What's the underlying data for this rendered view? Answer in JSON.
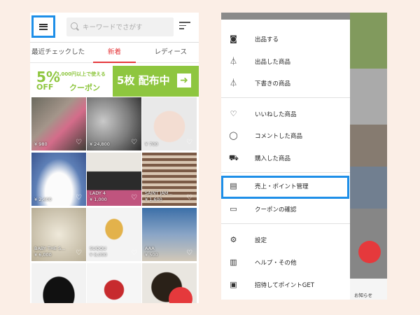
{
  "header": {
    "search_placeholder": "キーワードでさがす"
  },
  "tabs": [
    {
      "label": "最近チェックした",
      "active": false
    },
    {
      "label": "新着",
      "active": true
    },
    {
      "label": "レディース",
      "active": false
    }
  ],
  "banner": {
    "percent": "5%",
    "off": "OFF",
    "condition": "3,000円以上で使える",
    "coupon": "クーポン",
    "right_text": "5枚 配布中",
    "accent": "#8ec63f"
  },
  "products": [
    {
      "price": "¥ 980",
      "name": ""
    },
    {
      "price": "¥ 24,800",
      "name": ""
    },
    {
      "price": "¥ 700",
      "name": ""
    },
    {
      "price": "¥ 2,400",
      "name": ""
    },
    {
      "price": "¥ 1,000",
      "name": "LADY 4"
    },
    {
      "price": "¥ 1,600",
      "name": "SAINT JAM..."
    },
    {
      "price": "¥ 6,000",
      "name": "BABY THE S..."
    },
    {
      "price": "¥ 8,000",
      "name": "SUQQU"
    },
    {
      "price": "¥ 500",
      "name": "AAA"
    },
    {
      "price": "",
      "name": ""
    },
    {
      "price": "",
      "name": ""
    },
    {
      "price": "",
      "name": ""
    }
  ],
  "drawer": {
    "group1": [
      {
        "icon": "camera-icon",
        "glyph": "◙",
        "label": "出品する"
      },
      {
        "icon": "hanger-icon",
        "glyph": "⏃",
        "label": "出品した商品"
      },
      {
        "icon": "hanger-outline-icon",
        "glyph": "⏃",
        "label": "下書きの商品"
      }
    ],
    "group2": [
      {
        "icon": "heart-icon",
        "glyph": "♡",
        "label": "いいねした商品"
      },
      {
        "icon": "comment-icon",
        "glyph": "◯",
        "label": "コメントした商品"
      },
      {
        "icon": "cart-icon",
        "glyph": "⛟",
        "label": "購入した商品"
      }
    ],
    "group3": [
      {
        "icon": "wallet-icon",
        "glyph": "▤",
        "label": "売上・ポイント管理"
      },
      {
        "icon": "coupon-icon",
        "glyph": "▭",
        "label": "クーポンの確認"
      }
    ],
    "group4": [
      {
        "icon": "gear-icon",
        "glyph": "⚙",
        "label": "設定"
      },
      {
        "icon": "book-icon",
        "glyph": "▥",
        "label": "ヘルプ・その他"
      },
      {
        "icon": "invite-icon",
        "glyph": "▣",
        "label": "招待してポイントGET"
      }
    ]
  },
  "behind": {
    "notice_label": "お知らせ"
  },
  "colors": {
    "highlight": "#1e8fe8",
    "brand_red": "#e5393c"
  }
}
